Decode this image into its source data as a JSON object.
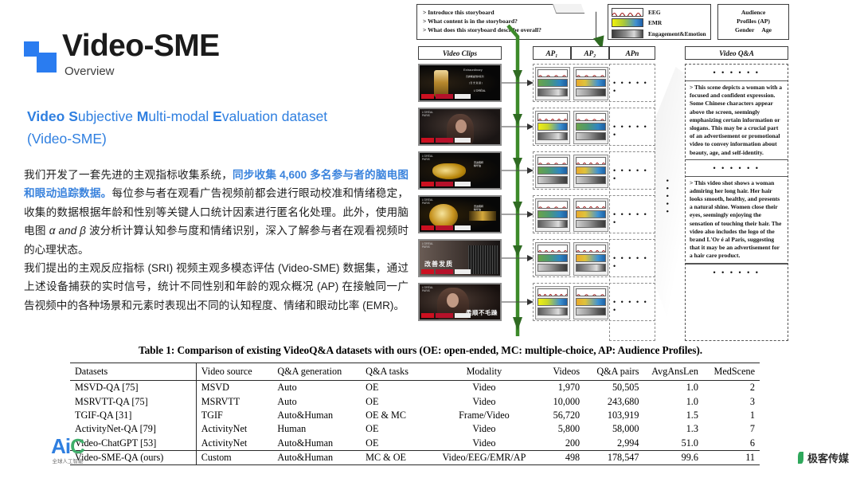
{
  "brand": {
    "title": "Video-SME",
    "subtitle": "Overview",
    "logo_color": "#2a7cf0"
  },
  "headline": {
    "line1_parts": [
      {
        "t": "Video",
        "bold": true
      },
      {
        "t": " ",
        "bold": false
      },
      {
        "t": "S",
        "bold": true
      },
      {
        "t": "ubjective ",
        "bold": false
      },
      {
        "t": "M",
        "bold": true
      },
      {
        "t": "ulti-modal ",
        "bold": false
      },
      {
        "t": "E",
        "bold": true
      },
      {
        "t": "valuation dataset",
        "bold": false
      }
    ],
    "line2": "(Video-SME)",
    "color": "#2f7fe0"
  },
  "body": {
    "seg1": "我们开发了一套先进的主观指标收集系统，",
    "seg_highlight": "同步收集 4,600 多名参与者的脑电图和眼动追踪数据。",
    "seg2": "每位参与者在观看广告视频前都会进行眼动校准和情绪稳定，收集的数据根据年龄和性别等关键人口统计因素进行匿名化处理。此外，使用脑电图 ",
    "seg_italic": "α and β",
    "seg3": " 波分析计算认知参与度和情绪识别，深入了解参与者在观看视频时的心理状态。",
    "para2": "我们提出的主观反应指标 (SRI) 视频主观多模态评估 (Video-SME) 数据集，通过上述设备捕获的实时信号，统计不同性别和年龄的观众概况 (AP) 在接触同一广告视频中的各种场景和元素时表现出不同的认知程度、情绪和眼动比率 (EMR)。"
  },
  "diagram": {
    "prompt_lines": [
      "> Introduce this storyboard",
      "> What content is in the storyboard?",
      "> What does this storyboard describe overall?"
    ],
    "legend": [
      {
        "label": "EEG",
        "swatch": "eeg-waveform-swatch"
      },
      {
        "label": "EMR",
        "swatch": "emr-gradient-swatch"
      },
      {
        "label": "Engagement&Emotion",
        "swatch": "engagement-gradient-swatch"
      }
    ],
    "audience_profile_box": {
      "line1": "Audience",
      "line2": "Profiles (AP)",
      "gender": "Gender",
      "age": "Age"
    },
    "column_headers": {
      "clips": "Video Clips",
      "ap1": "AP₁",
      "ap2": "AP₂",
      "apn": "APn",
      "qa": "Video Q&A"
    },
    "clips": [
      {
        "caption": "L'ORÉAL shampoo bottle product shot"
      },
      {
        "caption": "Woman with long dark hair"
      },
      {
        "caption": "Golden hair-care texture swirl"
      },
      {
        "caption": "Golden serum droplet bowl"
      },
      {
        "caption": "改善发质"
      },
      {
        "caption": "柔顺不毛躁"
      }
    ],
    "ap_dots": "• • • • • •",
    "vertical_dots": "• • • • •",
    "qa_panel": {
      "dots_top": "• • • • • •",
      "text1": "> This scene depicts a woman with a focused and confident expression. Some Chinese characters appear above the screen, seemingly emphasizing certain information or slogans. This may be a crucial part of an advertisement or promotional video to convey information about beauty, age, and self-identity.",
      "dots_mid": "• • • • • •",
      "text2": "> This video shot shows a woman admiring her long hair. Her hair looks smooth, healthy, and presents a natural shine. Women close their eyes, seemingly enjoying the sensation of touching their hair. The video also includes the logo of the brand L'Or é al Paris, suggesting that it may be an advertisement for a hair care product.",
      "dots_bottom": "• • • • • •"
    },
    "arrow_color": "#2f7b22"
  },
  "table": {
    "caption": "Table 1: Comparison of existing VideoQ&A datasets with ours (OE: open-ended, MC: multiple-choice, AP: Audience Profiles).",
    "headers": [
      "Datasets",
      "Video source",
      "Q&A generation",
      "Q&A tasks",
      "Modality",
      "Videos",
      "Q&A pairs",
      "AvgAnsLen",
      "MedScene"
    ],
    "rows": [
      {
        "cells": [
          "MSVD-QA [75]",
          "MSVD",
          "Auto",
          "OE",
          "Video",
          "1,970",
          "50,505",
          "1.0",
          "2"
        ],
        "bold": [
          false,
          false,
          false,
          false,
          false,
          false,
          false,
          false,
          false
        ]
      },
      {
        "cells": [
          "MSRVTT-QA [75]",
          "MSRVTT",
          "Auto",
          "OE",
          "Video",
          "10,000",
          "243,680",
          "1.0",
          "3"
        ],
        "bold": [
          false,
          false,
          false,
          false,
          false,
          false,
          true,
          false,
          false
        ]
      },
      {
        "cells": [
          "TGIF-QA [31]",
          "TGIF",
          "Auto&Human",
          "OE & MC",
          "Frame/Video",
          "56,720",
          "103,919",
          "1.5",
          "1"
        ],
        "bold": [
          false,
          false,
          false,
          false,
          false,
          true,
          false,
          false,
          false
        ]
      },
      {
        "cells": [
          "ActivityNet-QA [79]",
          "ActivityNet",
          "Human",
          "OE",
          "Video",
          "5,800",
          "58,000",
          "1.3",
          "7"
        ],
        "bold": [
          false,
          false,
          false,
          false,
          false,
          false,
          false,
          false,
          false
        ]
      },
      {
        "cells": [
          "Video-ChatGPT [53]",
          "ActivityNet",
          "Auto&Human",
          "OE",
          "Video",
          "200",
          "2,994",
          "51.0",
          "6"
        ],
        "bold": [
          false,
          false,
          false,
          false,
          false,
          false,
          false,
          false,
          false
        ]
      }
    ],
    "ours_row": {
      "cells": [
        "Video-SME-QA (ours)",
        "Custom",
        "Auto&Human",
        "MC & OE",
        "Video/EEG/EMR/AP",
        "498",
        "178,547",
        "99.6",
        "11"
      ],
      "bold": [
        false,
        false,
        false,
        false,
        true,
        false,
        false,
        true,
        true
      ]
    }
  },
  "footer": {
    "left_mark": "AiC",
    "left_sub": "全球人工智能",
    "right_text": "极客传媒"
  }
}
